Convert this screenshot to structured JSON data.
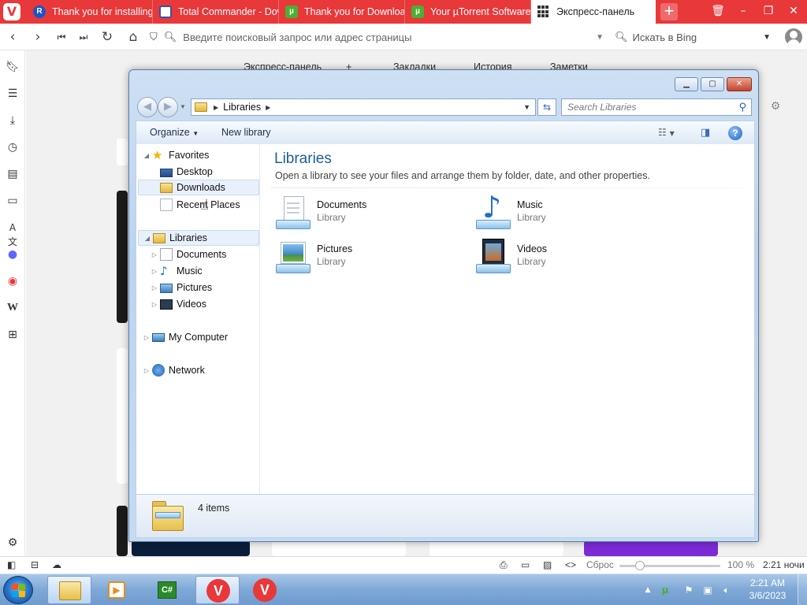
{
  "browser": {
    "tabs": [
      {
        "title": "Thank you for installing",
        "favicon": "rocket-icon"
      },
      {
        "title": "Total Commander - Dow",
        "favicon": "total-commander-icon"
      },
      {
        "title": "Thank you for Downloa",
        "favicon": "utorrent-icon"
      },
      {
        "title": "Your µTorrent Software",
        "favicon": "utorrent-icon"
      },
      {
        "title": "Экспресс-панель",
        "favicon": "speed-dial-icon"
      }
    ],
    "url_placeholder": "Введите поисковый запрос или адрес страницы",
    "search_placeholder": "Искать в Bing",
    "speed_dial_tabs": [
      "Экспресс-панель",
      "+",
      "Закладки",
      "История",
      "Заметки"
    ],
    "status": {
      "reset_label": "Сброс",
      "zoom": "100 %",
      "time": "2:21 ночи"
    },
    "accent_color": "#e8383a"
  },
  "explorer": {
    "breadcrumb": "Libraries",
    "search_placeholder": "Search Libraries",
    "commands": {
      "organize": "Organize",
      "new_library": "New library"
    },
    "nav": {
      "favorites": "Favorites",
      "favorites_items": [
        "Desktop",
        "Downloads",
        "Recent Places"
      ],
      "libraries": "Libraries",
      "library_items": [
        "Documents",
        "Music",
        "Pictures",
        "Videos"
      ],
      "computer": "My Computer",
      "network": "Network"
    },
    "content": {
      "title": "Libraries",
      "description": "Open a library to see your files and arrange them by folder, date, and other properties.",
      "items": [
        {
          "name": "Documents",
          "type": "Library"
        },
        {
          "name": "Music",
          "type": "Library"
        },
        {
          "name": "Pictures",
          "type": "Library"
        },
        {
          "name": "Videos",
          "type": "Library"
        }
      ]
    },
    "details": {
      "count": "4 items"
    }
  },
  "taskbar": {
    "clock_time": "2:21 AM",
    "clock_date": "3/6/2023"
  }
}
